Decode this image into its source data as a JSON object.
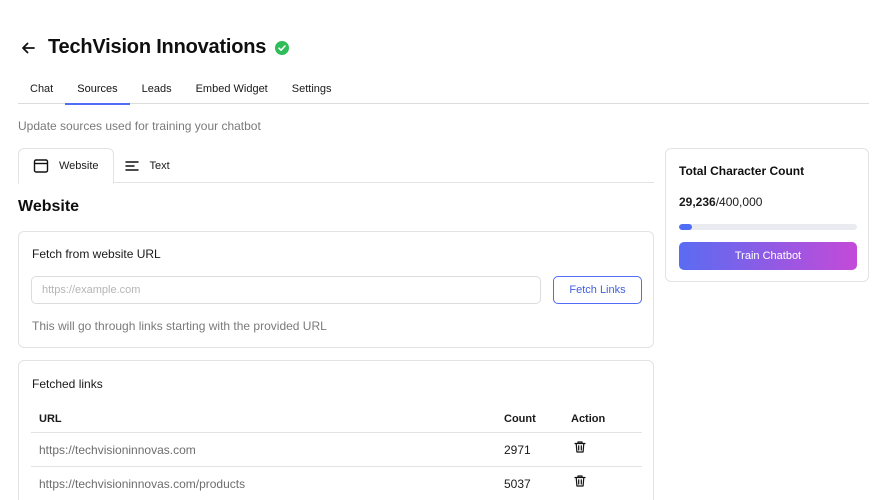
{
  "header": {
    "title": "TechVision Innovations",
    "verified_color": "#2ebd59"
  },
  "tabs": [
    {
      "label": "Chat",
      "active": false
    },
    {
      "label": "Sources",
      "active": true
    },
    {
      "label": "Leads",
      "active": false
    },
    {
      "label": "Embed Widget",
      "active": false
    },
    {
      "label": "Settings",
      "active": false
    }
  ],
  "subtitle": "Update sources used for training your chatbot",
  "source_tabs": [
    {
      "label": "Website",
      "icon": "browser-window-icon",
      "active": true
    },
    {
      "label": "Text",
      "icon": "text-lines-icon",
      "active": false
    }
  ],
  "section_title": "Website",
  "fetch": {
    "title": "Fetch from website URL",
    "placeholder": "https://example.com",
    "value": "",
    "button_label": "Fetch Links",
    "hint": "This will go through links starting with the provided URL"
  },
  "links": {
    "title": "Fetched links",
    "columns": [
      "URL",
      "Count",
      "Action"
    ],
    "rows": [
      {
        "url": "https://techvisioninnovas.com",
        "count": "2971"
      },
      {
        "url": "https://techvisioninnovas.com/products",
        "count": "5037"
      }
    ]
  },
  "summary": {
    "title": "Total Character Count",
    "current": "29,236",
    "limit": "/400,000",
    "progress_fraction": 0.073,
    "train_label": "Train Chatbot"
  },
  "colors": {
    "accent": "#4f6df5",
    "gradient_start": "#5a6cf2",
    "gradient_end": "#c44ad8"
  }
}
